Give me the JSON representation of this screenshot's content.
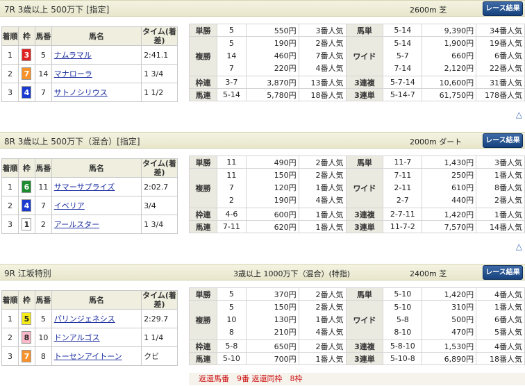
{
  "races": [
    {
      "title": "7R 3歳以上 500万下 [指定]",
      "mid": "",
      "dist": "2600m 芝",
      "btn": "レース結果",
      "horses": [
        {
          "rank": "1",
          "waku": "3",
          "wk": "w3",
          "num": "5",
          "name": "ナムラマル",
          "time": "2:41.1"
        },
        {
          "rank": "2",
          "waku": "7",
          "wk": "w7",
          "num": "14",
          "name": "マナローラ",
          "time": "1 3/4"
        },
        {
          "rank": "3",
          "waku": "4",
          "wk": "w4",
          "num": "7",
          "name": "サトノシリウス",
          "time": "1 1/2"
        }
      ],
      "tansho": {
        "k": "5",
        "y": "550円",
        "p": "3番人気"
      },
      "fukusho": [
        {
          "k": "5",
          "y": "190円",
          "p": "2番人気"
        },
        {
          "k": "14",
          "y": "460円",
          "p": "7番人気"
        },
        {
          "k": "7",
          "y": "220円",
          "p": "4番人気"
        }
      ],
      "wakuren": {
        "k": "3-7",
        "y": "3,870円",
        "p": "13番人気"
      },
      "umaren": {
        "k": "5-14",
        "y": "5,780円",
        "p": "18番人気"
      },
      "umatan": {
        "k": "5-14",
        "y": "9,390円",
        "p": "34番人気"
      },
      "wide": [
        {
          "k": "5-14",
          "y": "1,900円",
          "p": "19番人気"
        },
        {
          "k": "5-7",
          "y": "660円",
          "p": "6番人気"
        },
        {
          "k": "7-14",
          "y": "2,120円",
          "p": "22番人気"
        }
      ],
      "sanfuku": {
        "k": "5-7-14",
        "y": "10,600円",
        "p": "31番人気"
      },
      "santan": {
        "k": "5-14-7",
        "y": "61,750円",
        "p": "178番人気"
      }
    },
    {
      "title": "8R 3歳以上 500万下（混合）[指定]",
      "mid": "",
      "dist": "2000m ダート",
      "btn": "レース結果",
      "horses": [
        {
          "rank": "1",
          "waku": "6",
          "wk": "w6",
          "num": "11",
          "name": "サマーサプライズ",
          "time": "2:02.7"
        },
        {
          "rank": "2",
          "waku": "4",
          "wk": "w4",
          "num": "7",
          "name": "イベリア",
          "time": "3/4"
        },
        {
          "rank": "3",
          "waku": "1",
          "wk": "w1",
          "num": "2",
          "name": "アールスター",
          "time": "1 3/4"
        }
      ],
      "tansho": {
        "k": "11",
        "y": "490円",
        "p": "2番人気"
      },
      "fukusho": [
        {
          "k": "11",
          "y": "150円",
          "p": "2番人気"
        },
        {
          "k": "7",
          "y": "120円",
          "p": "1番人気"
        },
        {
          "k": "2",
          "y": "190円",
          "p": "4番人気"
        }
      ],
      "wakuren": {
        "k": "4-6",
        "y": "600円",
        "p": "1番人気"
      },
      "umaren": {
        "k": "7-11",
        "y": "620円",
        "p": "1番人気"
      },
      "umatan": {
        "k": "11-7",
        "y": "1,430円",
        "p": "3番人気"
      },
      "wide": [
        {
          "k": "7-11",
          "y": "250円",
          "p": "1番人気"
        },
        {
          "k": "2-11",
          "y": "610円",
          "p": "8番人気"
        },
        {
          "k": "2-7",
          "y": "440円",
          "p": "2番人気"
        }
      ],
      "sanfuku": {
        "k": "2-7-11",
        "y": "1,420円",
        "p": "1番人気"
      },
      "santan": {
        "k": "11-7-2",
        "y": "7,570円",
        "p": "14番人気"
      }
    },
    {
      "title": "9R 江坂特別",
      "mid": "3歳以上 1000万下（混合）(特指)",
      "dist": "2400m 芝",
      "btn": "レース結果",
      "horses": [
        {
          "rank": "1",
          "waku": "5",
          "wk": "w5",
          "num": "5",
          "name": "パリンジェネシス",
          "time": "2:29.7"
        },
        {
          "rank": "2",
          "waku": "8",
          "wk": "w8",
          "num": "10",
          "name": "ドンアルゴス",
          "time": "1 1/4"
        },
        {
          "rank": "3",
          "waku": "7",
          "wk": "w7",
          "num": "8",
          "name": "トーセンアイトーン",
          "time": "クビ"
        }
      ],
      "tansho": {
        "k": "5",
        "y": "370円",
        "p": "2番人気"
      },
      "fukusho": [
        {
          "k": "5",
          "y": "150円",
          "p": "2番人気"
        },
        {
          "k": "10",
          "y": "130円",
          "p": "1番人気"
        },
        {
          "k": "8",
          "y": "210円",
          "p": "4番人気"
        }
      ],
      "wakuren": {
        "k": "5-8",
        "y": "650円",
        "p": "2番人気"
      },
      "umaren": {
        "k": "5-10",
        "y": "700円",
        "p": "1番人気"
      },
      "umatan": {
        "k": "5-10",
        "y": "1,420円",
        "p": "4番人気"
      },
      "wide": [
        {
          "k": "5-10",
          "y": "310円",
          "p": "1番人気"
        },
        {
          "k": "5-8",
          "y": "500円",
          "p": "6番人気"
        },
        {
          "k": "8-10",
          "y": "470円",
          "p": "5番人気"
        }
      ],
      "sanfuku": {
        "k": "5-8-10",
        "y": "1,530円",
        "p": "4番人気"
      },
      "santan": {
        "k": "5-10-8",
        "y": "6,890円",
        "p": "18番人気"
      }
    }
  ],
  "labels": {
    "rank": "着順",
    "waku": "枠",
    "uma": "馬番",
    "name": "馬名",
    "time": "タイム(着差)",
    "tansho": "単勝",
    "fukusho": "複勝",
    "wakuren": "枠連",
    "umaren": "馬連",
    "umatan": "馬単",
    "wide": "ワイド",
    "sanfuku": "3連複",
    "santan": "3連単",
    "top": "△"
  },
  "henkan": "返還馬番　9番 返還同枠　8枠"
}
